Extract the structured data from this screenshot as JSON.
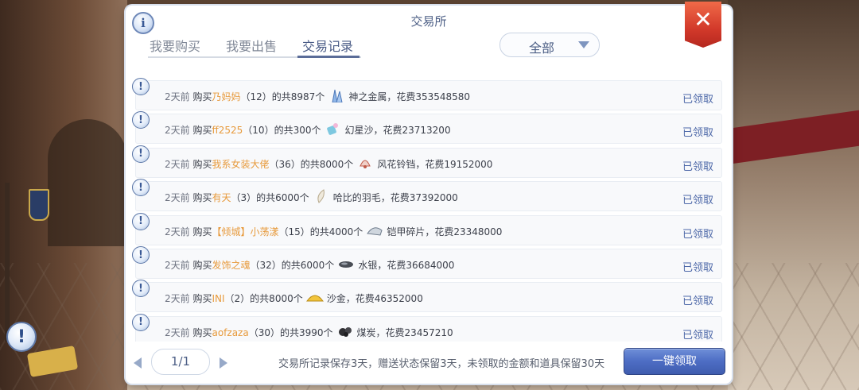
{
  "window": {
    "title": "交易所",
    "info_icon": "info-icon",
    "close_icon": "close-icon",
    "close_symbol": "✕"
  },
  "tabs": [
    {
      "label": "我要购买",
      "active": false
    },
    {
      "label": "我要出售",
      "active": false
    },
    {
      "label": "交易记录",
      "active": true
    }
  ],
  "filter": {
    "value": "全部"
  },
  "records": [
    {
      "ago": "2天前",
      "action": "购买",
      "seller": "乃妈妈",
      "qty_prefix": "（12）的共8987个",
      "item": "神之金属",
      "cost": "，花费353548580",
      "status": "已领取",
      "icon": "crystal-icon"
    },
    {
      "ago": "2天前",
      "action": "购买",
      "seller": "ff2525",
      "qty_prefix": "（10）的共300个",
      "item": "幻星沙",
      "cost": "，花费23713200",
      "status": "已领取",
      "icon": "stardust-icon"
    },
    {
      "ago": "2天前",
      "action": "购买",
      "seller": "我系女装大佬",
      "qty_prefix": "（36）的共8000个",
      "item": "风花铃铛",
      "cost": "，花费19152000",
      "status": "已领取",
      "icon": "bell-icon"
    },
    {
      "ago": "2天前",
      "action": "购买",
      "seller": "有天",
      "qty_prefix": "（3）的共6000个",
      "item": "哈比的羽毛",
      "cost": "，花费37392000",
      "status": "已领取",
      "icon": "feather-icon"
    },
    {
      "ago": "2天前",
      "action": "购买",
      "seller": "【倾城】小荡漾",
      "qty_prefix": "（15）的共4000个",
      "item": "铠甲碎片",
      "cost": "，花费23348000",
      "status": "已领取",
      "icon": "armor-shard-icon"
    },
    {
      "ago": "2天前",
      "action": "购买",
      "seller": "发饰之魂",
      "qty_prefix": "（32）的共6000个",
      "item": "水银",
      "cost": "，花费36684000",
      "status": "已领取",
      "icon": "mercury-icon"
    },
    {
      "ago": "2天前",
      "action": "购买",
      "seller": "INI",
      "qty_prefix": "（2）的共8000个",
      "item": "沙金",
      "cost": "，花费46352000",
      "status": "已领取",
      "icon": "gold-sand-icon"
    },
    {
      "ago": "2天前",
      "action": "购买",
      "seller": "aofzaza",
      "qty_prefix": "（30）的共3990个",
      "item": "煤炭",
      "cost": "，花费23457210",
      "status": "已领取",
      "icon": "coal-icon"
    }
  ],
  "footer": {
    "page": "1/1",
    "notice": "交易所记录保存3天，赠送状态保留3天，未领取的金额和道具保留30天",
    "claim_all": "一键领取"
  },
  "colors": {
    "accent": "#4d68a8",
    "seller": "#e79a3c",
    "close": "#d2392a"
  }
}
